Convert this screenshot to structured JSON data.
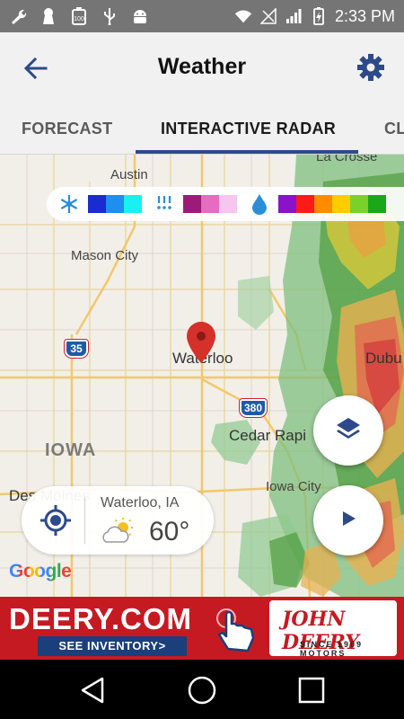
{
  "status_bar": {
    "time": "2:33 PM",
    "left_icons": [
      "wrench-icon",
      "keyhole-icon",
      "battery-100-icon",
      "usb-icon",
      "android-icon"
    ],
    "right_icons": [
      "wifi-icon",
      "no-signal-icon",
      "signal-icon",
      "battery-charging-icon"
    ]
  },
  "app_bar": {
    "title": "Weather",
    "back_icon": "arrow-back-icon",
    "settings_icon": "gear-icon",
    "accent": "#2d4a8a"
  },
  "tabs": [
    {
      "label": "FORECAST",
      "active": false
    },
    {
      "label": "INTERACTIVE RADAR",
      "active": true
    },
    {
      "label": "CL",
      "active": false
    }
  ],
  "map": {
    "legend": {
      "groups": [
        {
          "icon": "snowflake-icon",
          "colors": [
            "#1a2ccf",
            "#1e8ef0",
            "#19f0f0"
          ]
        },
        {
          "icon": "sleet-icon",
          "colors": [
            "#9c1b7a",
            "#e56cc0",
            "#f6c6ee"
          ]
        },
        {
          "icon": "raindrop-icon",
          "colors": [
            "#8a12c9",
            "#ff1a1a",
            "#ff8c00",
            "#ffcc00",
            "#7ad12b",
            "#1aa81a"
          ]
        }
      ]
    },
    "cities": [
      {
        "name": "Austin"
      },
      {
        "name": "Mason City"
      },
      {
        "name": "Waterloo"
      },
      {
        "name": "Cedar Rapi"
      },
      {
        "name": "Iowa City"
      },
      {
        "name": "Des Moines"
      },
      {
        "name": "Dubu"
      },
      {
        "name": "La Crosse"
      }
    ],
    "state_label": "IOWA",
    "highways": [
      "35",
      "380"
    ],
    "location_card": {
      "place": "Waterloo, IA",
      "temperature": "60°",
      "condition_icon": "partly-cloudy-icon",
      "locate_icon": "my-location-icon"
    },
    "attribution": "Google",
    "buttons": {
      "layers_icon": "layers-icon",
      "play_icon": "play-icon"
    }
  },
  "ad": {
    "brand": "DEERY.COM",
    "cta": "SEE INVENTORY>",
    "logo_line1": "JOHN DEERY",
    "logo_line2": "SINCE 1909 MOTORS",
    "hand_icon": "pointing-hand-icon"
  },
  "nav_bar": {
    "back_icon": "nav-back-icon",
    "home_icon": "nav-home-icon",
    "recents_icon": "nav-recents-icon"
  }
}
